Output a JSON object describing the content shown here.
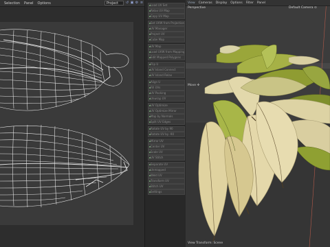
{
  "uv_editor": {
    "menu": [
      "Selection",
      "Panel",
      "Options"
    ],
    "project_select": "Project",
    "tool_icons": [
      "uv-sync-icon",
      "uv-lock-icon",
      "uv-settings-icon",
      "uv-stack-icon"
    ]
  },
  "command_list": {
    "items": [
      "Load UV Set",
      "Relax UV Map",
      "Copy UV Map",
      "Set UVW from Projection",
      "UV Manager",
      "Project UV",
      "Cube Map",
      "UV Map",
      "Load UVW from Mapping",
      "Edit Mapped Polygons",
      "Flip U",
      "UV Island Connect",
      "UV Island Relax",
      "Align U",
      "Fill UVs",
      "UV Packing",
      "Unwrap UV",
      "UV Optimize",
      "UV Optimize Mirror",
      "Map by Normals",
      "Split UV Edges",
      "Rotate UV by 90",
      "Rotate UV by -90",
      "Mirror UV",
      "Center UV",
      "Scale UV",
      "UV Stitch",
      "Separate UV",
      "Unmapped",
      "Weld UV",
      "Transform UV",
      "Stitch UV",
      "Settings"
    ]
  },
  "viewport": {
    "menu": [
      "View",
      "Cameras",
      "Display",
      "Options",
      "Filter",
      "Panel"
    ],
    "view_name": "Perspective",
    "camera": "Default Camera",
    "camera_icon": "camera-orbit-icon",
    "tool_label": "Move",
    "tool_icon": "move-gizmo-icon",
    "status": "View Transform: Scene"
  }
}
